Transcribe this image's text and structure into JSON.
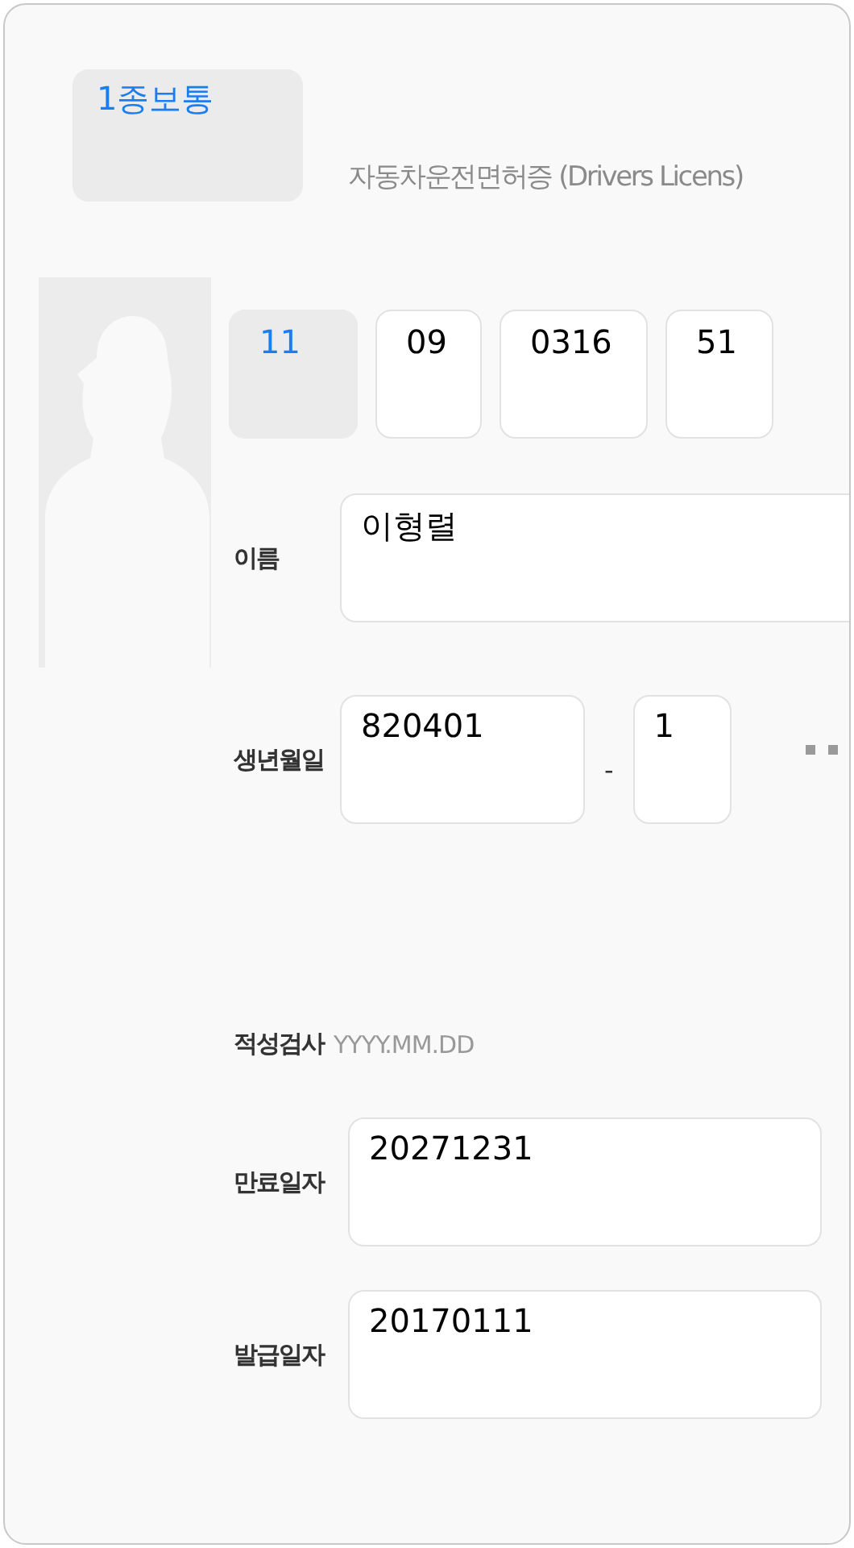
{
  "license_type": {
    "text": "1종보통",
    "kind": "readonly"
  },
  "title": "자동차운전면허증 (Drivers Licens)",
  "license_number": [
    {
      "value": "11",
      "kind": "readonly"
    },
    {
      "value": "09",
      "kind": "input"
    },
    {
      "value": "0316",
      "kind": "input"
    },
    {
      "value": "51",
      "kind": "input"
    }
  ],
  "name": {
    "label": "이름",
    "value": "이형렬"
  },
  "birth": {
    "label": "생년월일",
    "value": "820401",
    "separator": "-",
    "gender_digit": "1"
  },
  "aptitude_test": {
    "label": "적성검사",
    "placeholder": "YYYY.MM.DD"
  },
  "expiry": {
    "label": "만료일자",
    "value": "20271231"
  },
  "issue": {
    "label": "발급일자",
    "value": "20170111"
  }
}
